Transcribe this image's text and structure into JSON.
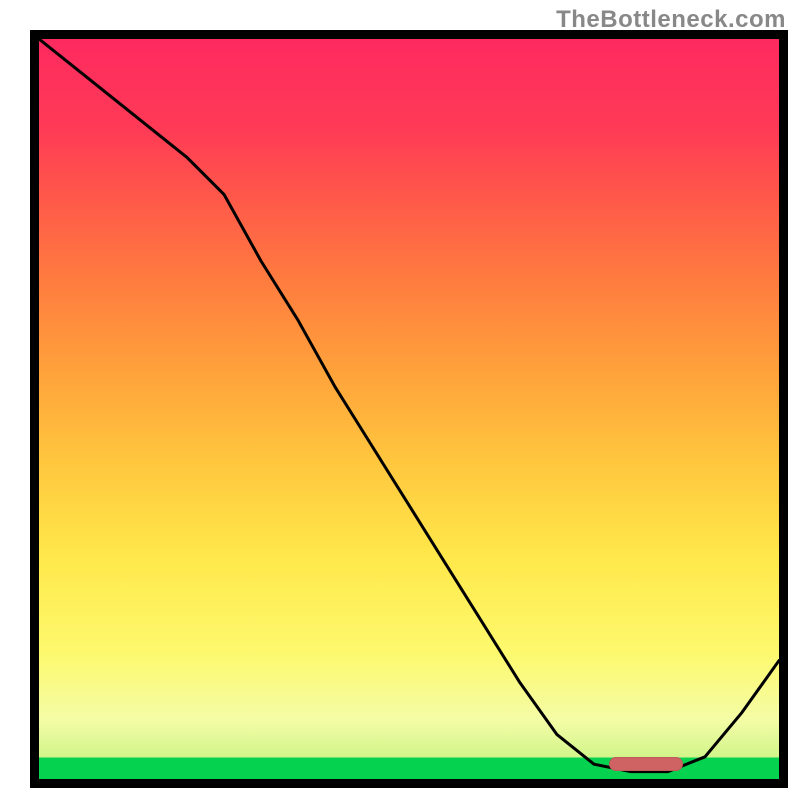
{
  "watermark": "TheBottleneck.com",
  "chart_data": {
    "type": "line",
    "title": "",
    "xlabel": "",
    "ylabel": "",
    "xlim": [
      0,
      100
    ],
    "ylim": [
      0,
      100
    ],
    "grid": false,
    "legend": null,
    "x": [
      0,
      5,
      10,
      15,
      20,
      25,
      30,
      35,
      40,
      45,
      50,
      55,
      60,
      65,
      70,
      75,
      80,
      85,
      90,
      95,
      100
    ],
    "series": [
      {
        "name": "bottleneck_curve",
        "values": [
          100,
          96,
          92,
          88,
          84,
          79,
          70,
          62,
          53,
          45,
          37,
          29,
          21,
          13,
          6,
          2,
          1,
          1,
          3,
          9,
          16
        ]
      }
    ],
    "marker": {
      "x_start": 77,
      "x_end": 87,
      "y": 2,
      "color": "#cf6363"
    },
    "gradient_stops": [
      {
        "pos": 0.0,
        "color": "#05d24e"
      },
      {
        "pos": 0.03,
        "color": "#d2f58b"
      },
      {
        "pos": 0.08,
        "color": "#f4fca6"
      },
      {
        "pos": 0.17,
        "color": "#fdf96e"
      },
      {
        "pos": 0.3,
        "color": "#ffe84a"
      },
      {
        "pos": 0.43,
        "color": "#ffc63e"
      },
      {
        "pos": 0.55,
        "color": "#ffa23b"
      },
      {
        "pos": 0.67,
        "color": "#ff7d3f"
      },
      {
        "pos": 0.78,
        "color": "#ff5a49"
      },
      {
        "pos": 0.88,
        "color": "#ff3a56"
      },
      {
        "pos": 1.0,
        "color": "#fd2a60"
      }
    ]
  }
}
